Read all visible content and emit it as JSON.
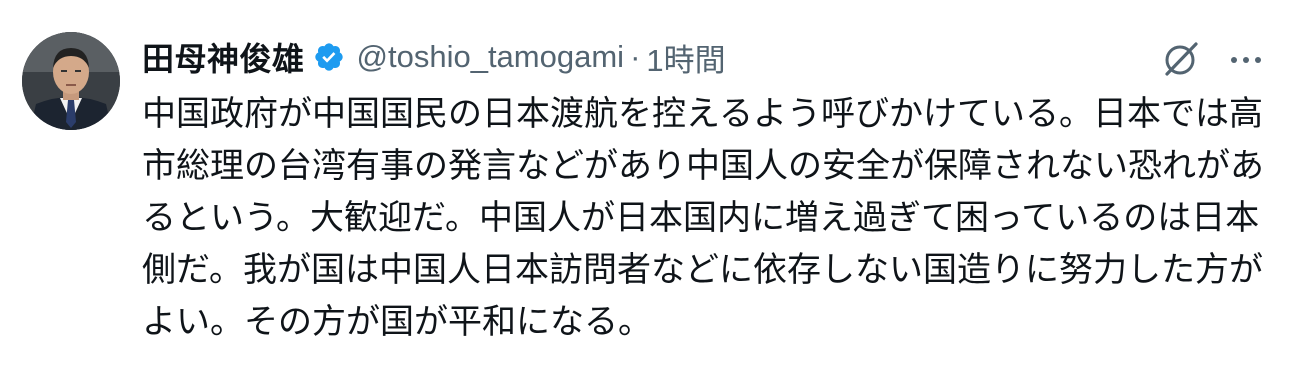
{
  "tweet": {
    "display_name": "田母神俊雄",
    "handle": "@toshio_tamogami",
    "separator": "·",
    "time": "1時間",
    "verified_color": "#1d9bf0",
    "text": "中国政府が中国国民の日本渡航を控えるよう呼びかけている。日本では高市総理の台湾有事の発言などがあり中国人の安全が保障されない恐れがあるという。大歓迎だ。中国人が日本国内に増え過ぎて困っているのは日本側だ。我が国は中国人日本訪問者などに依存しない国造りに努力した方がよい。その方が国が平和になる。"
  },
  "icons": {
    "avatar": "profile-photo",
    "verified": "verified-badge-icon",
    "grok": "grok-icon",
    "more": "more-options-icon"
  }
}
